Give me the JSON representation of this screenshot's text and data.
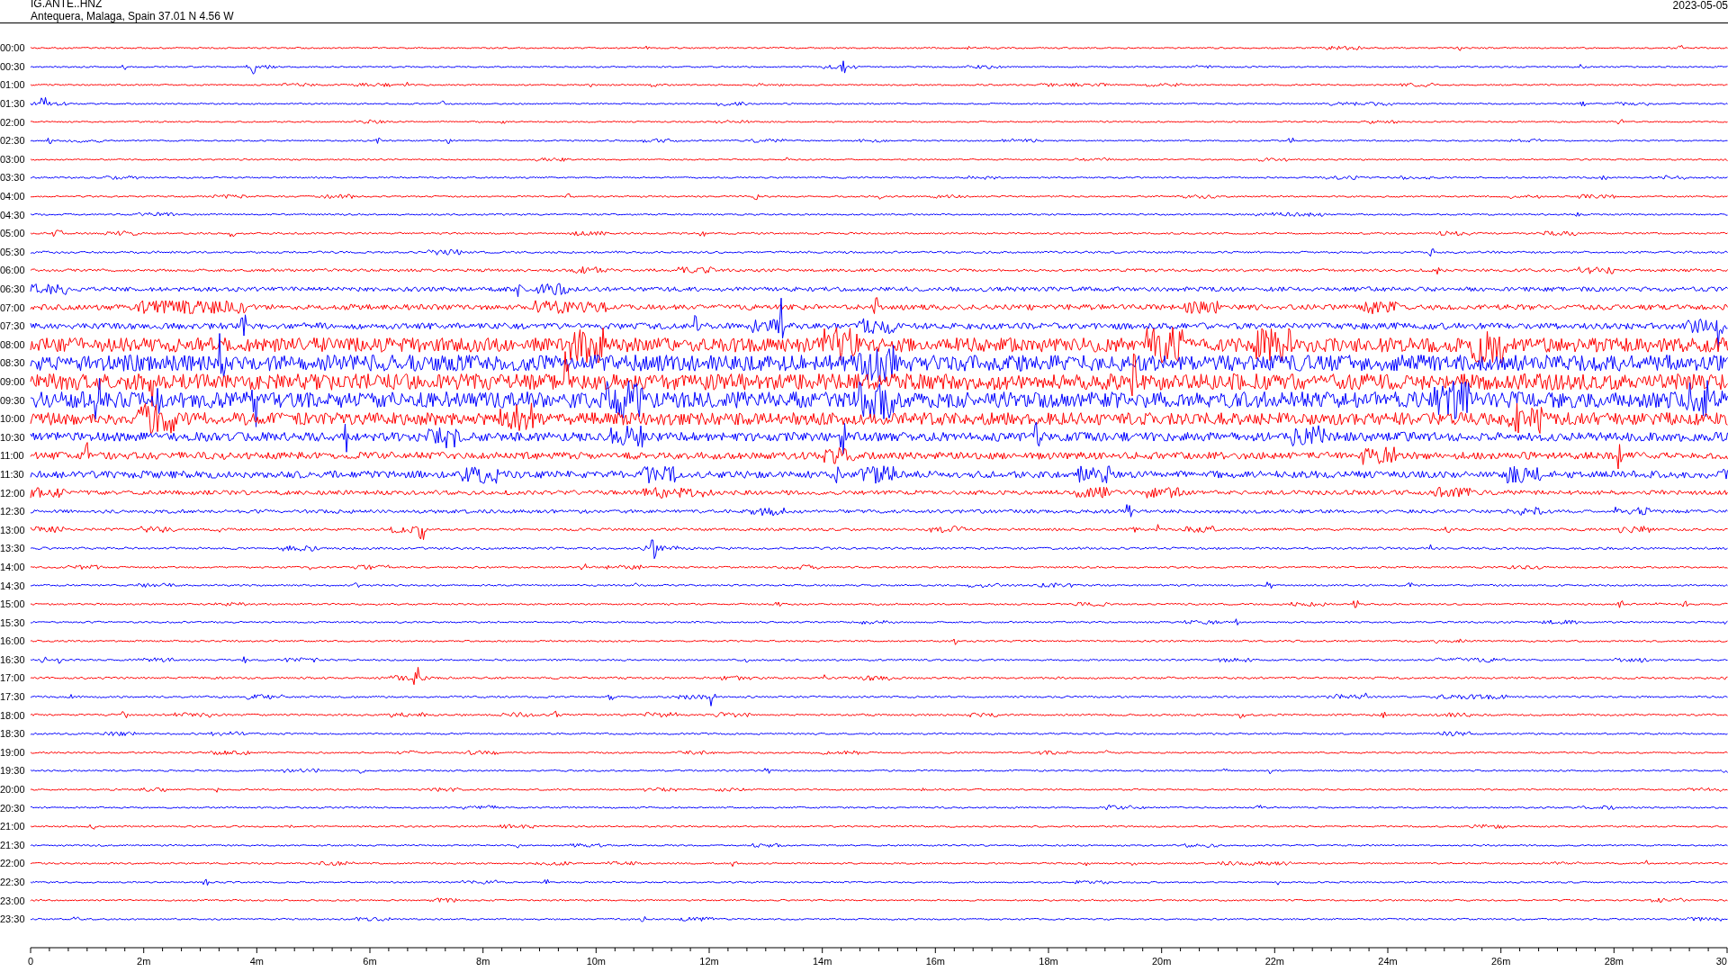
{
  "header": {
    "station": "IG.ANTE..HNZ",
    "location": "Antequera, Malaga, Spain  37.01 N 4.56 W",
    "date": "2023-05-05"
  },
  "rows": [
    {
      "label": "00:00",
      "color": "#ff0000"
    },
    {
      "label": "00:30",
      "color": "#0000ff"
    },
    {
      "label": "01:00",
      "color": "#ff0000"
    },
    {
      "label": "01:30",
      "color": "#0000ff"
    },
    {
      "label": "02:00",
      "color": "#ff0000"
    },
    {
      "label": "02:30",
      "color": "#0000ff"
    },
    {
      "label": "03:00",
      "color": "#ff0000"
    },
    {
      "label": "03:30",
      "color": "#0000ff"
    },
    {
      "label": "04:00",
      "color": "#ff0000"
    },
    {
      "label": "04:30",
      "color": "#0000ff"
    },
    {
      "label": "05:00",
      "color": "#ff0000"
    },
    {
      "label": "05:30",
      "color": "#0000ff"
    },
    {
      "label": "06:00",
      "color": "#ff0000"
    },
    {
      "label": "06:30",
      "color": "#0000ff"
    },
    {
      "label": "07:00",
      "color": "#ff0000"
    },
    {
      "label": "07:30",
      "color": "#0000ff"
    },
    {
      "label": "08:00",
      "color": "#ff0000"
    },
    {
      "label": "08:30",
      "color": "#0000ff"
    },
    {
      "label": "09:00",
      "color": "#ff0000"
    },
    {
      "label": "09:30",
      "color": "#0000ff"
    },
    {
      "label": "10:00",
      "color": "#ff0000"
    },
    {
      "label": "10:30",
      "color": "#0000ff"
    },
    {
      "label": "11:00",
      "color": "#ff0000"
    },
    {
      "label": "11:30",
      "color": "#0000ff"
    },
    {
      "label": "12:00",
      "color": "#ff0000"
    },
    {
      "label": "12:30",
      "color": "#0000ff"
    },
    {
      "label": "13:00",
      "color": "#ff0000"
    },
    {
      "label": "13:30",
      "color": "#0000ff"
    },
    {
      "label": "14:00",
      "color": "#ff0000"
    },
    {
      "label": "14:30",
      "color": "#0000ff"
    },
    {
      "label": "15:00",
      "color": "#ff0000"
    },
    {
      "label": "15:30",
      "color": "#0000ff"
    },
    {
      "label": "16:00",
      "color": "#ff0000"
    },
    {
      "label": "16:30",
      "color": "#0000ff"
    },
    {
      "label": "17:00",
      "color": "#ff0000"
    },
    {
      "label": "17:30",
      "color": "#0000ff"
    },
    {
      "label": "18:00",
      "color": "#ff0000"
    },
    {
      "label": "18:30",
      "color": "#0000ff"
    },
    {
      "label": "19:00",
      "color": "#ff0000"
    },
    {
      "label": "19:30",
      "color": "#0000ff"
    },
    {
      "label": "20:00",
      "color": "#ff0000"
    },
    {
      "label": "20:30",
      "color": "#0000ff"
    },
    {
      "label": "21:00",
      "color": "#ff0000"
    },
    {
      "label": "21:30",
      "color": "#0000ff"
    },
    {
      "label": "22:00",
      "color": "#ff0000"
    },
    {
      "label": "22:30",
      "color": "#0000ff"
    },
    {
      "label": "23:00",
      "color": "#ff0000"
    },
    {
      "label": "23:30",
      "color": "#0000ff"
    }
  ],
  "x_axis": {
    "tick_labels": [
      "0",
      "2m",
      "4m",
      "6m",
      "8m",
      "10m",
      "12m",
      "14m",
      "16m",
      "18m",
      "20m",
      "22m",
      "24m",
      "26m",
      "28m",
      "30"
    ]
  }
}
